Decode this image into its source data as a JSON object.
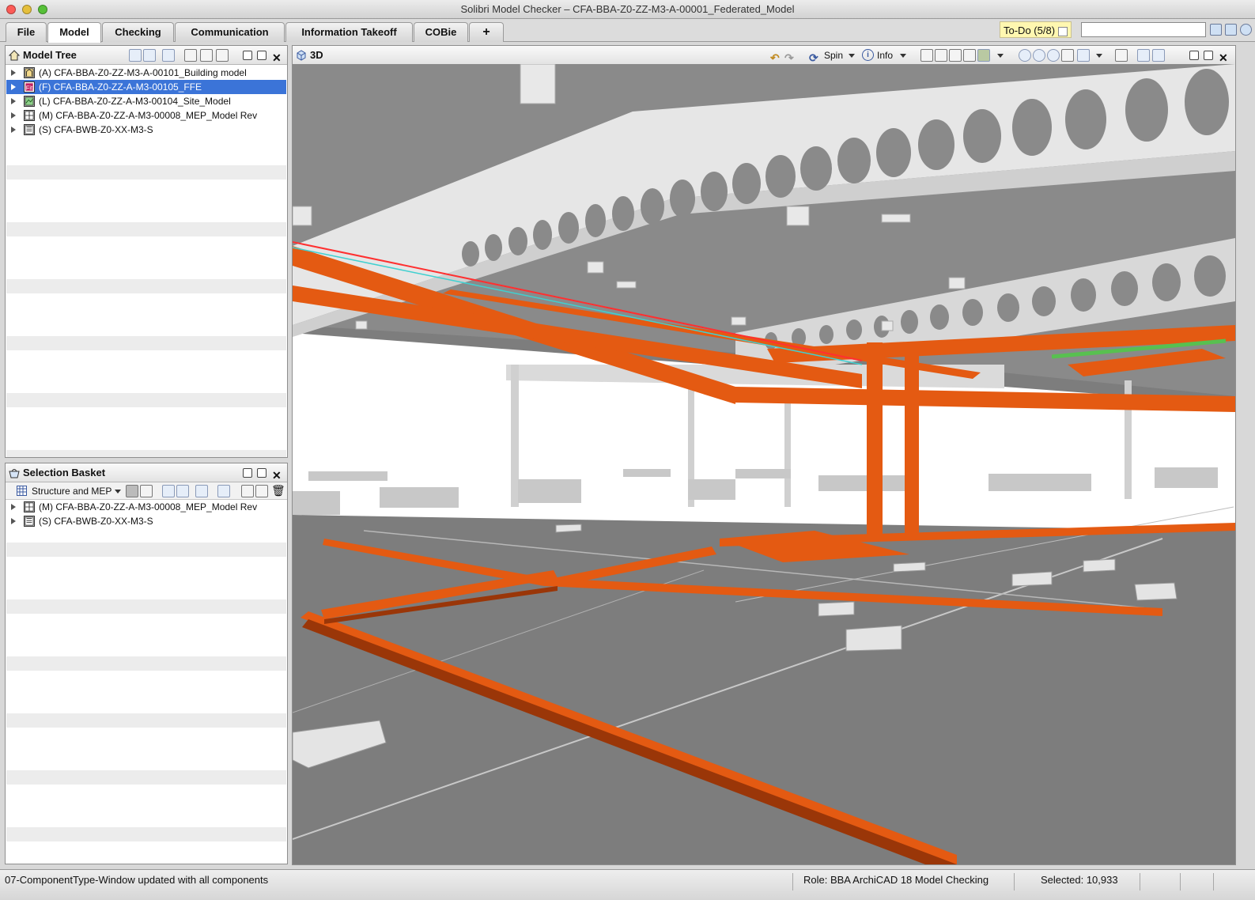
{
  "window": {
    "title": "Solibri Model Checker – CFA-BBA-Z0-ZZ-M3-A-00001_Federated_Model"
  },
  "menu_tabs": [
    "File",
    "Model",
    "Checking",
    "Communication",
    "Information Takeoff",
    "COBie",
    "+"
  ],
  "active_tab": "Model",
  "todo": {
    "label": "To-Do (5/8)",
    "search_value": ""
  },
  "model_tree": {
    "title": "Model Tree",
    "items": [
      {
        "label": "(A) CFA-BBA-Z0-ZZ-M3-A-00101_Building model",
        "icon": "building-model-icon",
        "selected": false
      },
      {
        "label": "(F) CFA-BBA-Z0-ZZ-A-M3-00105_FFE",
        "icon": "ffe-model-icon",
        "selected": true
      },
      {
        "label": "(L) CFA-BBA-Z0-ZZ-A-M3-00104_Site_Model",
        "icon": "site-model-icon",
        "selected": false
      },
      {
        "label": "(M) CFA-BBA-Z0-ZZ-A-M3-00008_MEP_Model Rev",
        "icon": "mep-model-icon",
        "selected": false
      },
      {
        "label": "(S) CFA-BWB-Z0-XX-M3-S",
        "icon": "structure-model-icon",
        "selected": false
      }
    ]
  },
  "selection_basket": {
    "title": "Selection Basket",
    "filter": "Structure and MEP",
    "items": [
      {
        "label": "(M) CFA-BBA-Z0-ZZ-A-M3-00008_MEP_Model Rev",
        "icon": "mep-model-icon"
      },
      {
        "label": "(S) CFA-BWB-Z0-XX-M3-S",
        "icon": "structure-model-icon"
      }
    ]
  },
  "view3d": {
    "title": "3D",
    "spin_label": "Spin",
    "info_label": "Info"
  },
  "status": {
    "message": "07-ComponentType-Window updated with all components",
    "role": "Role: BBA ArchiCAD 18 Model Checking",
    "selected": "Selected: 10,933"
  },
  "colors": {
    "selection": "#3b74d8",
    "duct_orange": "#e45a12",
    "duct_shade": "#9a3608",
    "floor_grey": "#7d7d7d",
    "ceiling_grey": "#8a8a8a"
  }
}
